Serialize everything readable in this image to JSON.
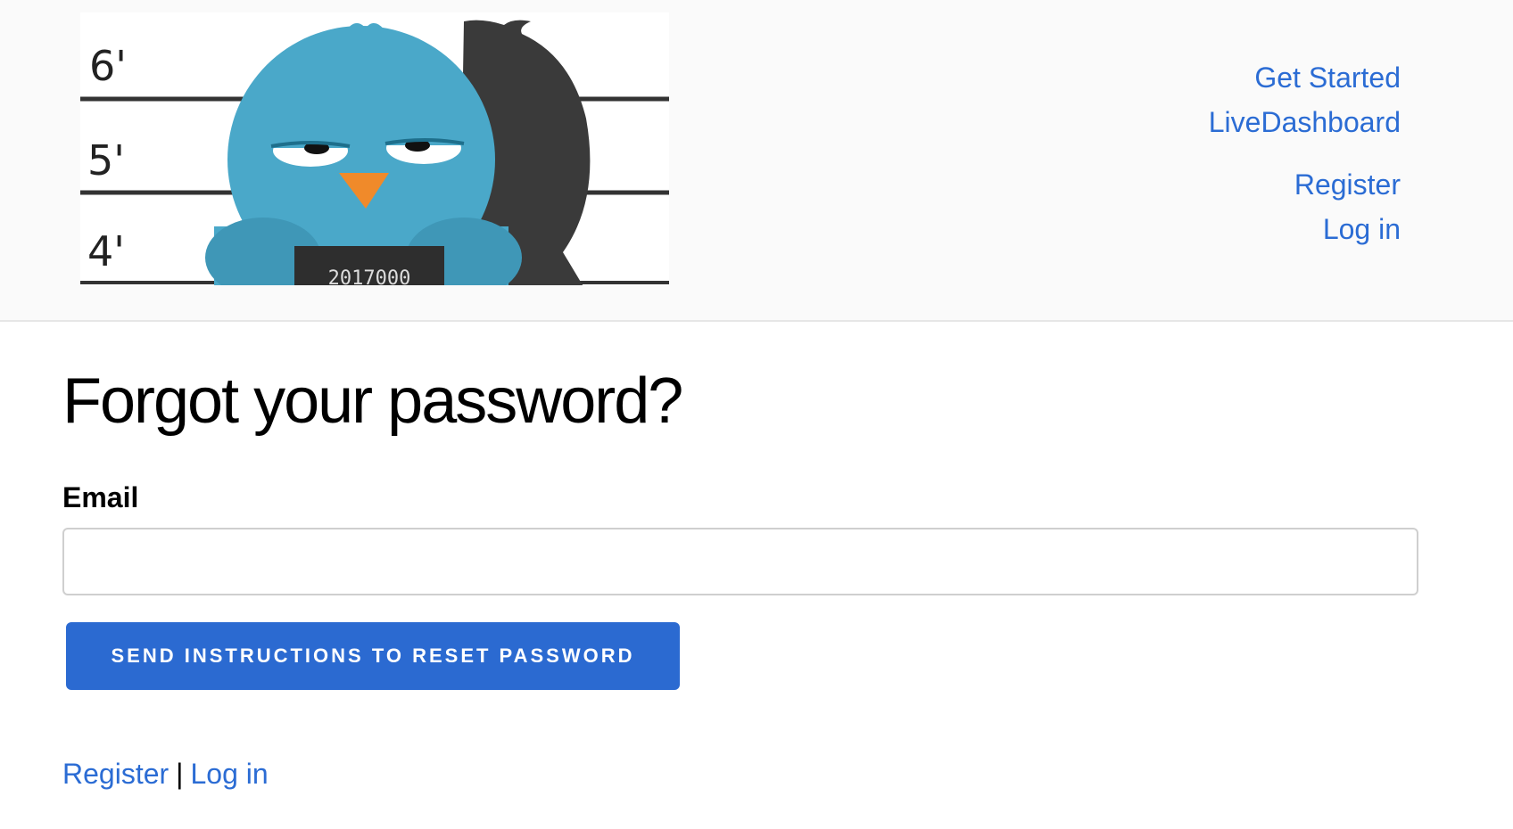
{
  "header": {
    "logo": {
      "height_marks": [
        "6'",
        "5'",
        "4'"
      ],
      "placard_text": "2017000"
    },
    "nav": {
      "get_started": "Get Started",
      "live_dashboard": "LiveDashboard",
      "register": "Register",
      "log_in": "Log in"
    }
  },
  "main": {
    "title": "Forgot your password?",
    "email_label": "Email",
    "email_value": "",
    "submit_label": "SEND INSTRUCTIONS TO RESET PASSWORD",
    "footer": {
      "register": "Register",
      "separator": "|",
      "log_in": "Log in"
    }
  },
  "colors": {
    "link": "#2b6cd4",
    "button": "#2b6ad1",
    "bird_body": "#4aa8c9",
    "beak": "#f08a2a"
  }
}
